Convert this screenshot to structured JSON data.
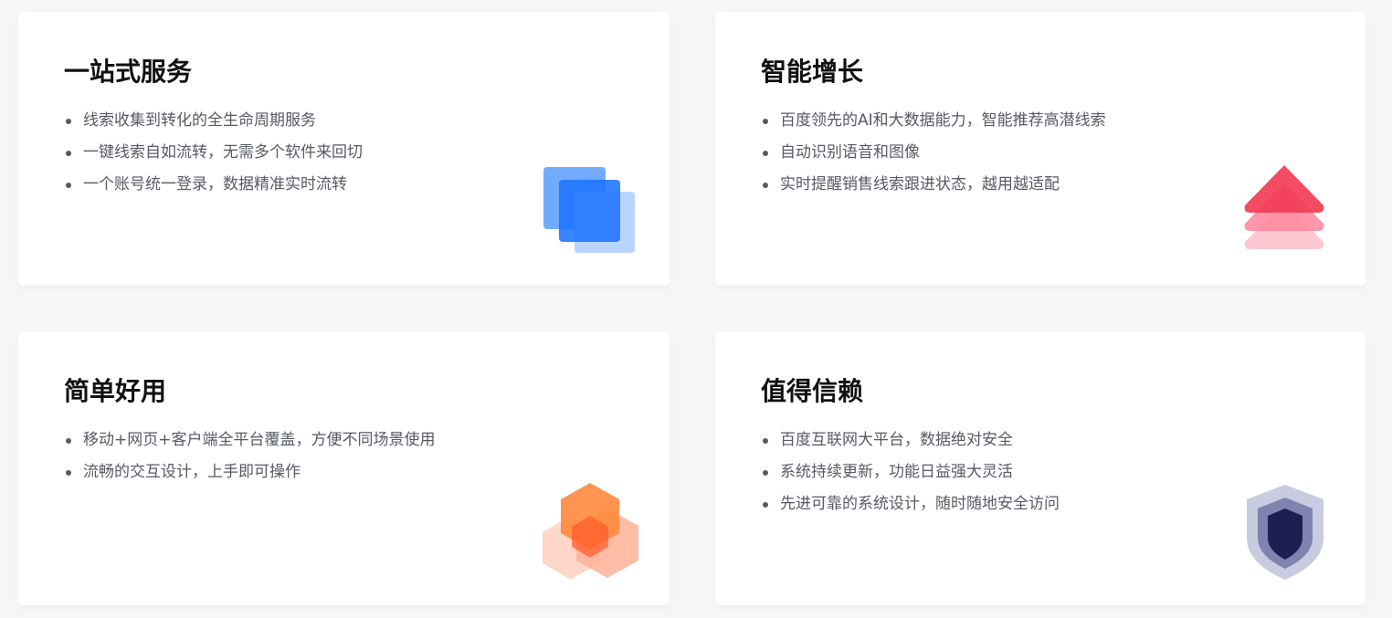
{
  "cards": [
    {
      "title": "一站式服务",
      "icon": "stacked-squares-icon",
      "items": [
        "线索收集到转化的全生命周期服务",
        "一键线索自如流转，无需多个软件来回切",
        "一个账号统一登录，数据精准实时流转"
      ]
    },
    {
      "title": "智能增长",
      "icon": "stacked-arrows-up-icon",
      "items": [
        "百度领先的AI和大数据能力，智能推荐高潜线索",
        "自动识别语音和图像",
        "实时提醒销售线索跟进状态，越用越适配"
      ]
    },
    {
      "title": "简单好用",
      "icon": "hexagon-cluster-icon",
      "items": [
        "移动+网页+客户端全平台覆盖，方便不同场景使用",
        "流畅的交互设计，上手即可操作"
      ]
    },
    {
      "title": "值得信赖",
      "icon": "shield-icon",
      "items": [
        "百度互联网大平台，数据绝对安全",
        "系统持续更新，功能日益强大灵活",
        "先进可靠的系统设计，随时随地安全访问"
      ]
    }
  ],
  "colors": {
    "background": "#f5f6f8",
    "card": "#ffffff",
    "title": "#111111",
    "text": "#555a63",
    "blue": "#1e73ff",
    "red": "#f23c55",
    "orange": "#ff6b35",
    "navy": "#1c1f52"
  }
}
